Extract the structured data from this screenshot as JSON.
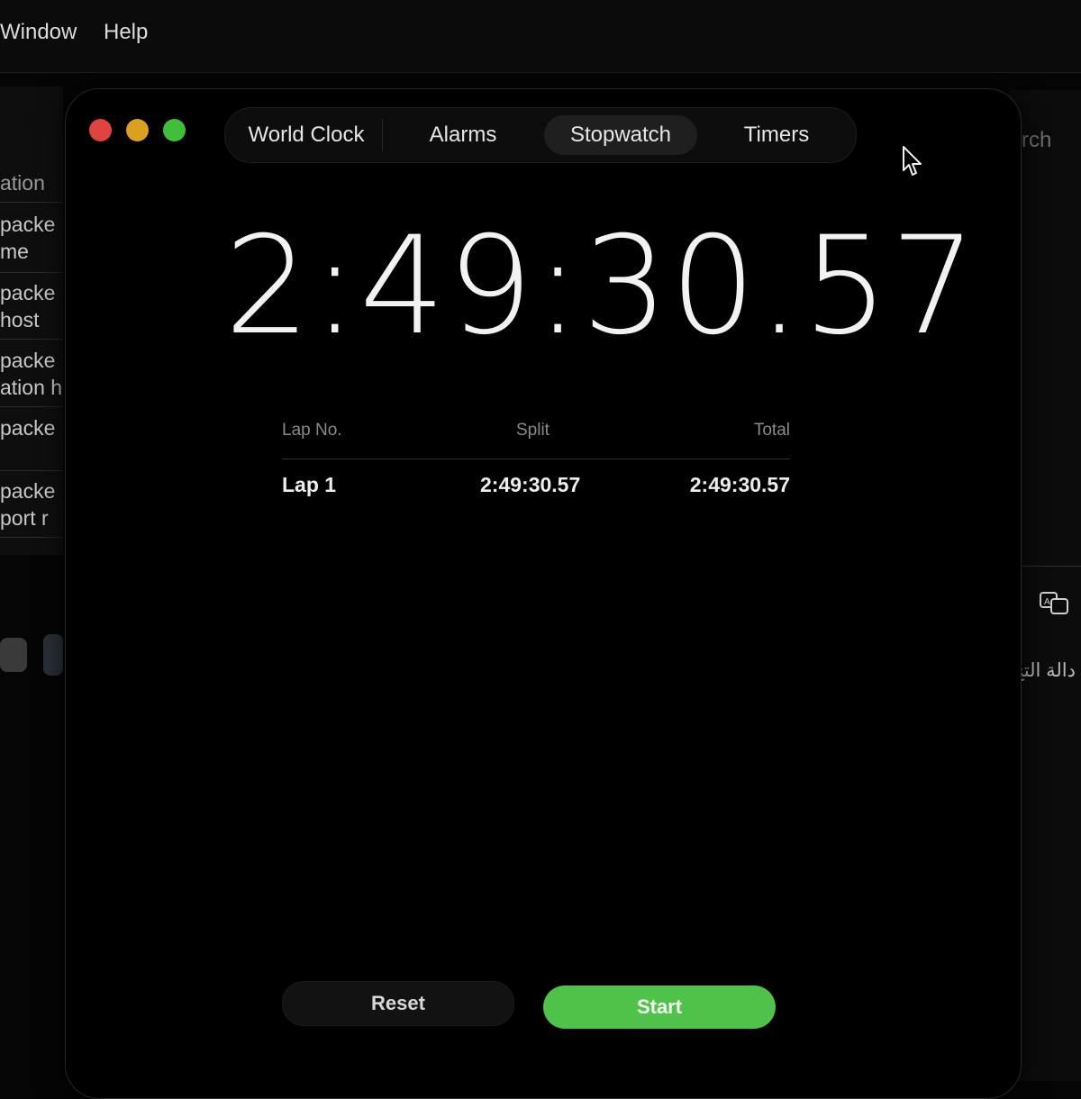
{
  "menubar": {
    "items": [
      "Window",
      "Help"
    ]
  },
  "background_left": {
    "header": "ation",
    "rows": [
      "packe",
      "me",
      "packe",
      "host",
      "packe",
      "ation h",
      "packe",
      "packe",
      "port r"
    ]
  },
  "background_right": {
    "search_fragment": "rch",
    "arabic_text": "دالة التج",
    "translate_icon": "translate-icon"
  },
  "window": {
    "tabs": [
      "World Clock",
      "Alarms",
      "Stopwatch",
      "Timers"
    ],
    "active_tab": "Stopwatch",
    "elapsed_time": "2:49:30.57",
    "laps": {
      "headers": {
        "lap_no": "Lap No.",
        "split": "Split",
        "total": "Total"
      },
      "rows": [
        {
          "lap": "Lap 1",
          "split": "2:49:30.57",
          "total": "2:49:30.57"
        }
      ]
    },
    "buttons": {
      "reset": "Reset",
      "start": "Start"
    },
    "colors": {
      "start_button": "#4fc24a",
      "close": "#e0443e",
      "minimize": "#dba01f",
      "zoom": "#3fbf3a"
    }
  }
}
